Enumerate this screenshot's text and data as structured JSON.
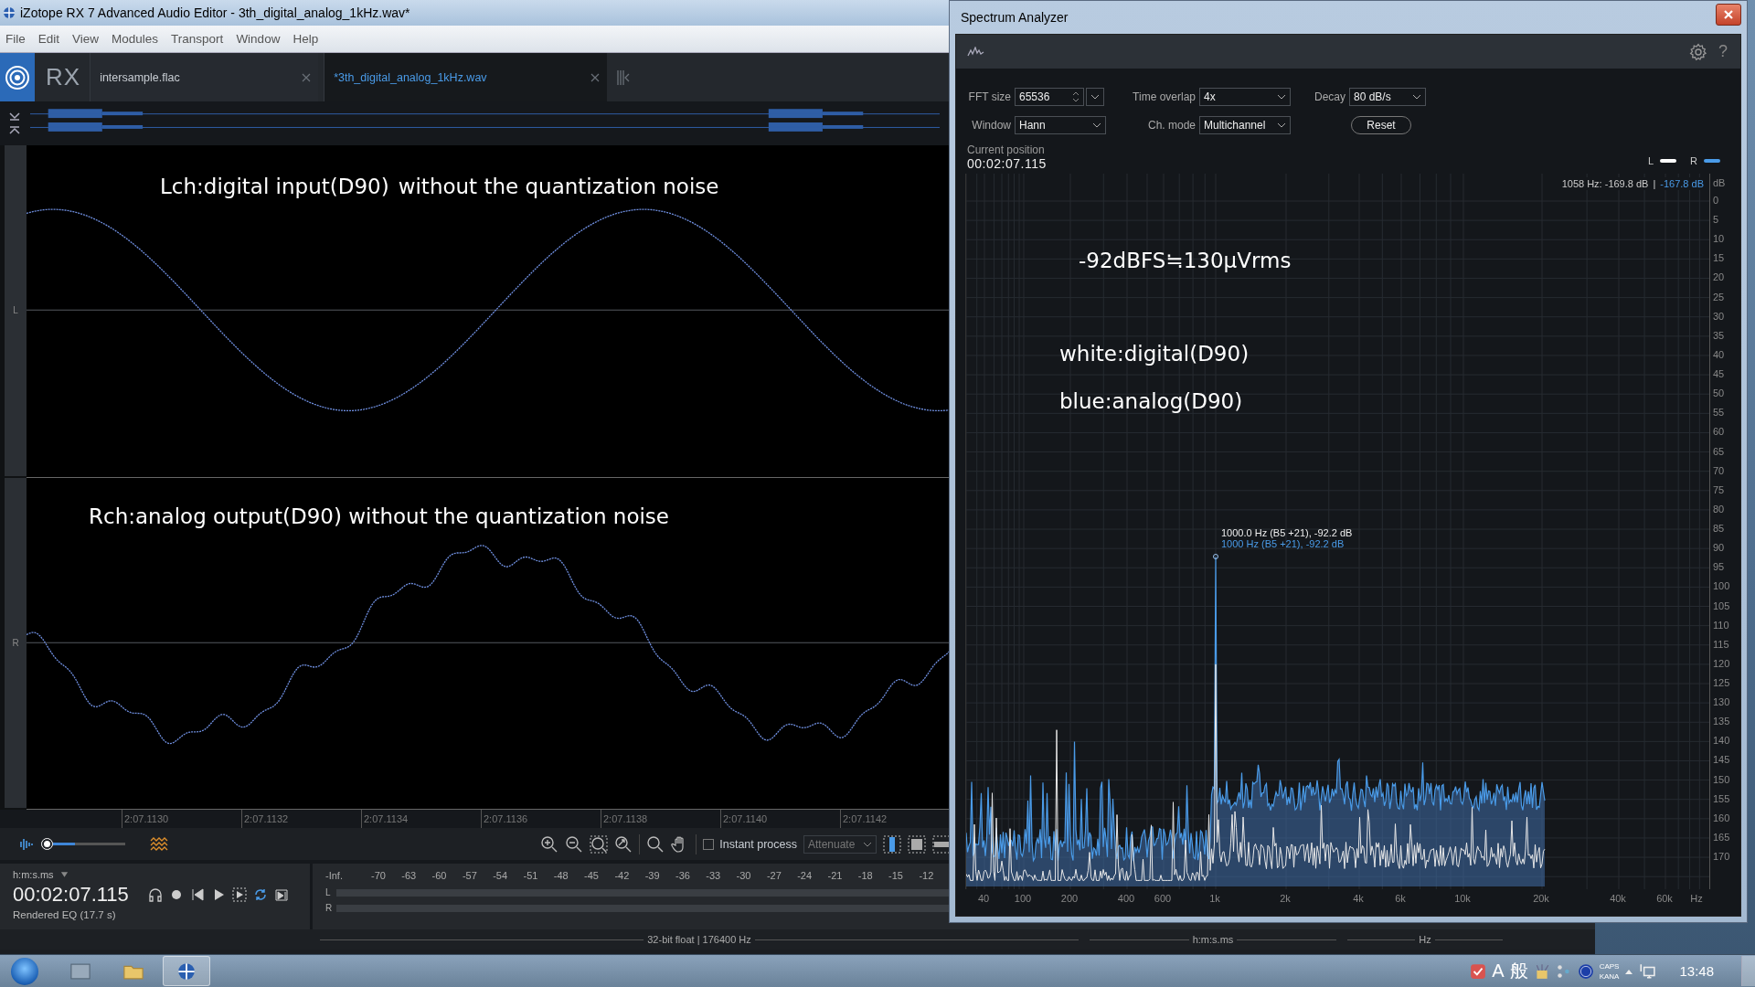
{
  "editor": {
    "title": "iZotope RX 7 Advanced Audio Editor - 3th_digital_analog_1kHz.wav*",
    "menu": [
      "File",
      "Edit",
      "View",
      "Modules",
      "Transport",
      "Window",
      "Help"
    ],
    "logo": "RX",
    "tabs": [
      {
        "label": "intersample.flac",
        "selected": false
      },
      {
        "label": "*3th_digital_analog_1kHz.wav",
        "selected": true
      }
    ],
    "channels": [
      {
        "label": "L",
        "kind": "clean",
        "notes": [
          "Lch:digital input(D90)",
          "without the quantization noise"
        ]
      },
      {
        "label": "R",
        "kind": "distorted",
        "notes": [
          "Rch:analog output(D90) without the quantization noise"
        ]
      }
    ],
    "time_ticks": [
      "2:07.1130",
      "2:07.1132",
      "2:07.1134",
      "2:07.1136",
      "2:07.1138",
      "2:07.1140",
      "2:07.1142"
    ],
    "zoom_slider": {
      "level": 0.4
    },
    "instant_process": {
      "label": "Instant process",
      "checked": false
    },
    "mode_select": "Attenuate",
    "time_format": "h:m:s.ms",
    "time": "00:02:07.115",
    "status": "Rendered EQ (17.7 s)",
    "meter_ticks": [
      "-Inf.",
      "-70",
      "-63",
      "-60",
      "-57",
      "-54",
      "-51",
      "-48",
      "-45",
      "-42",
      "-39",
      "-36",
      "-33",
      "-30",
      "-27",
      "-24",
      "-21",
      "-18",
      "-15",
      "-12"
    ],
    "meter_channels": [
      "L",
      "R"
    ],
    "status_bar": [
      "32-bit float | 176400 Hz",
      "h:m:s.ms",
      "Hz"
    ]
  },
  "spectrum": {
    "title": "Spectrum Analyzer",
    "help": "?",
    "fields": [
      {
        "kind": "spin",
        "label": "FFT size",
        "value": "65536"
      },
      {
        "kind": "select",
        "label": "Time overlap",
        "value": "4x"
      },
      {
        "kind": "select",
        "label": "Decay",
        "value": "80 dB/s"
      },
      {
        "kind": "select",
        "label": "Window",
        "value": "Hann"
      },
      {
        "kind": "select",
        "label": "Ch. mode",
        "value": "Multichannel"
      },
      {
        "kind": "button",
        "label": "Reset"
      }
    ],
    "position_label": "Current position",
    "position": "00:02:07.115",
    "legend": [
      {
        "label": "L",
        "color": "#ffffff"
      },
      {
        "label": "R",
        "color": "#4a9be8"
      }
    ],
    "readout": {
      "left": "1058 Hz: -169.8 dB",
      "separator": "|",
      "right": "-167.8 dB"
    },
    "peak_labels": [
      "1000.0 Hz (B5 +21), -92.2 dB",
      "1000 Hz (B5 +21), -92.2 dB"
    ],
    "notes": [
      "-92dBFS≒130μVrms",
      "white:digital(D90)",
      "blue:analog(D90)"
    ],
    "y_ticks": [
      "dB",
      "0",
      "5",
      "10",
      "15",
      "20",
      "25",
      "30",
      "35",
      "40",
      "45",
      "50",
      "55",
      "60",
      "65",
      "70",
      "75",
      "80",
      "85",
      "90",
      "95",
      "100",
      "105",
      "110",
      "115",
      "120",
      "125",
      "130",
      "135",
      "140",
      "145",
      "150",
      "155",
      "160",
      "165",
      "170"
    ],
    "x_ticks": [
      "40",
      "100",
      "200",
      "400",
      "600",
      "1k",
      "2k",
      "4k",
      "6k",
      "10k",
      "20k",
      "40k",
      "60k",
      "Hz"
    ]
  },
  "taskbar": {
    "ime": [
      "A",
      "般"
    ],
    "caps": "CAPS",
    "kana": "KANA",
    "clock": "13:48"
  }
}
